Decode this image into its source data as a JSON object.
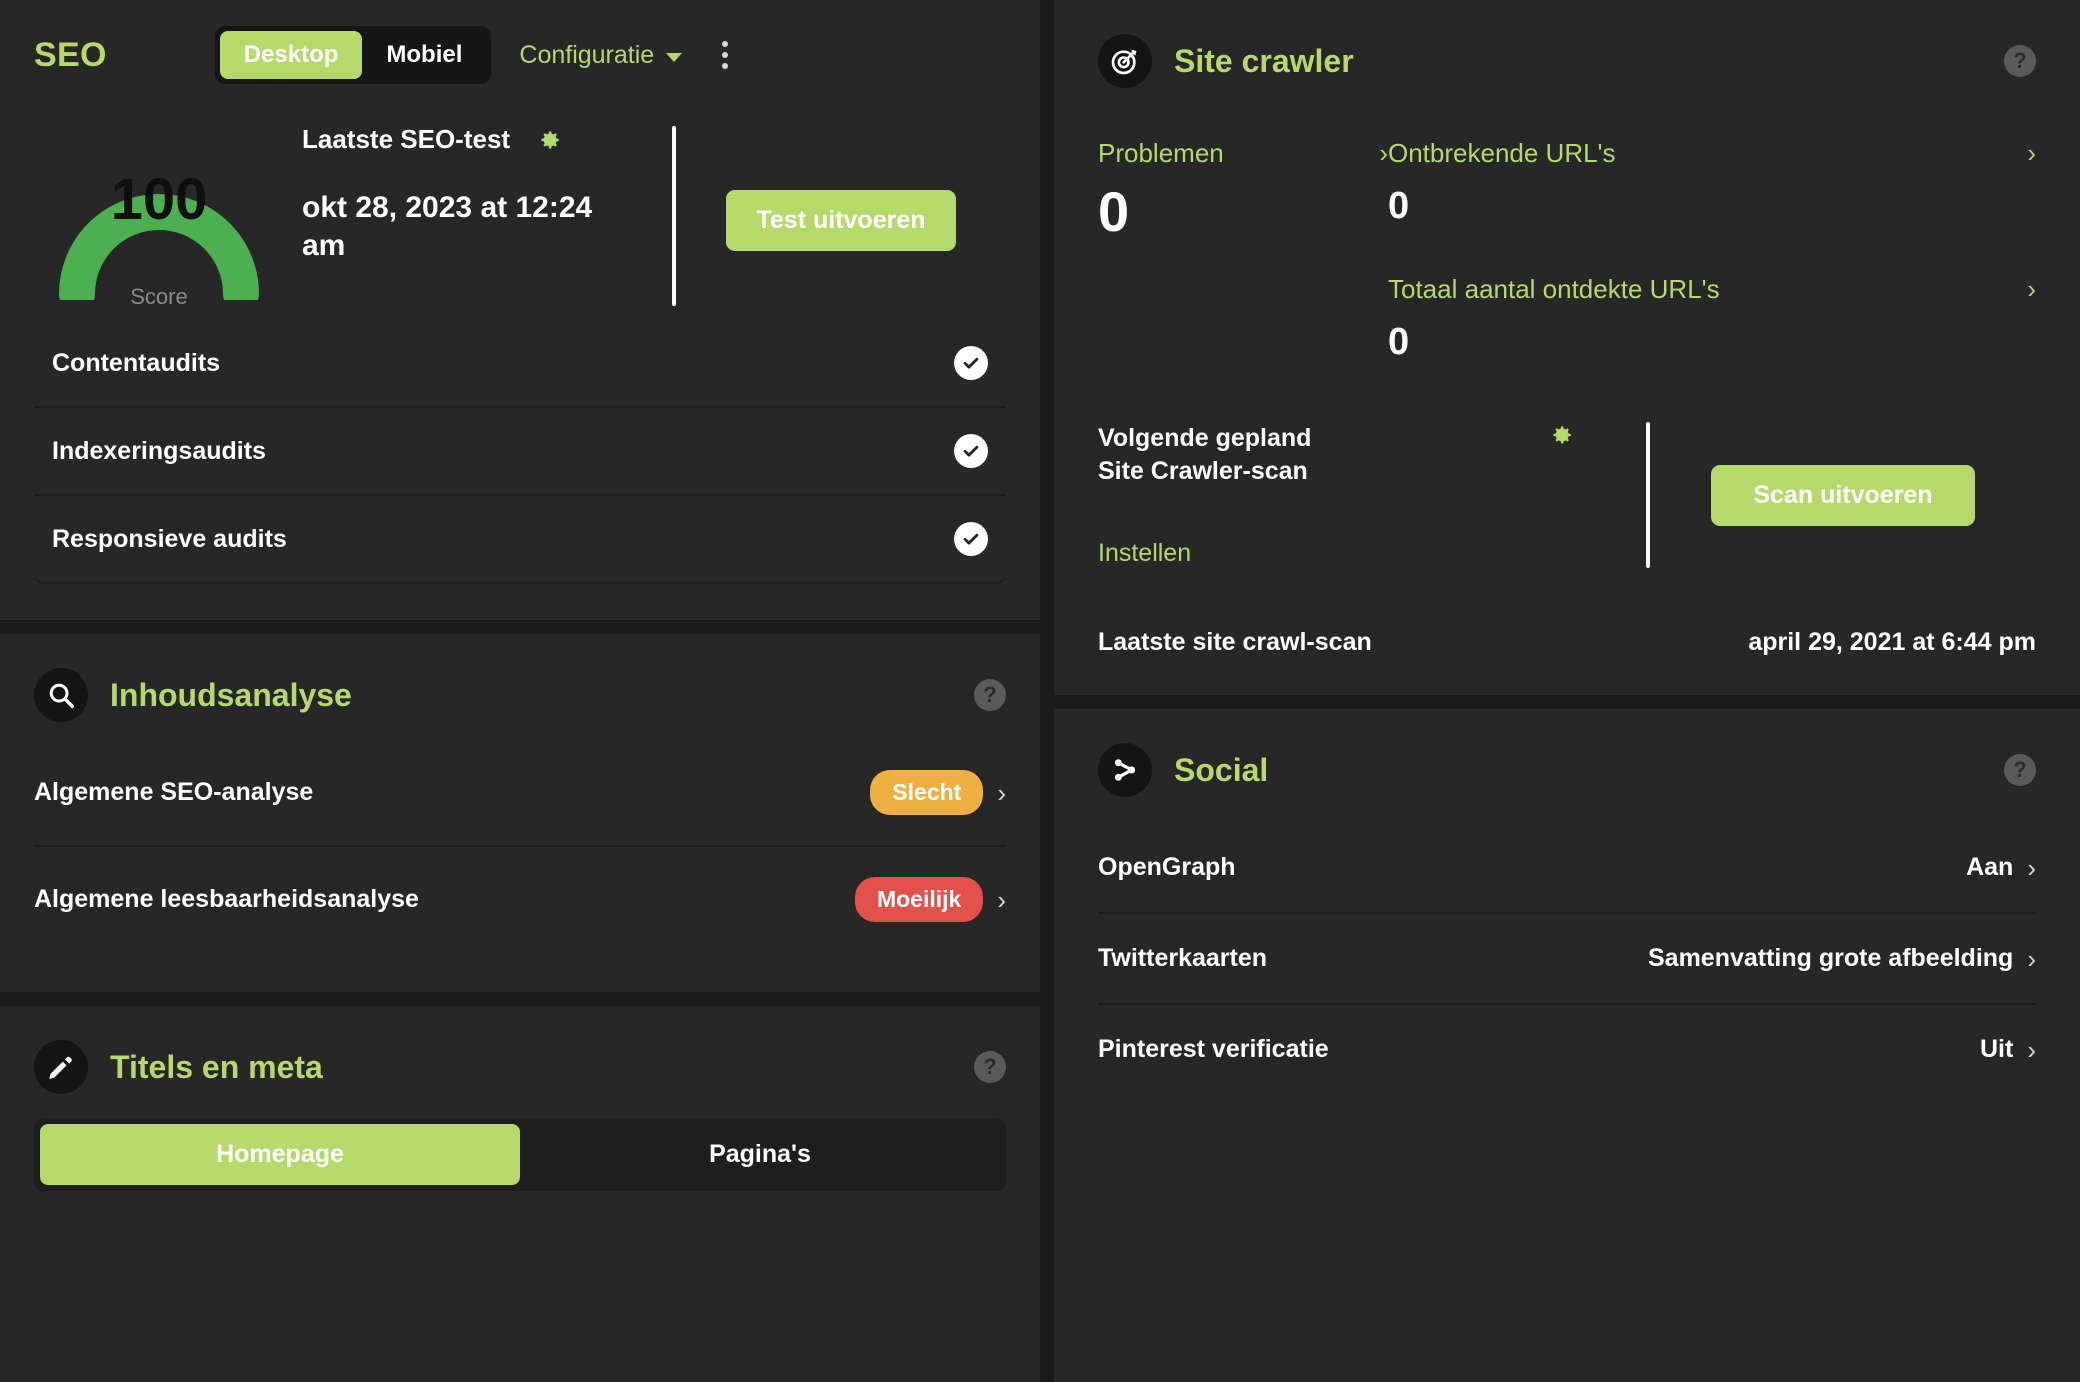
{
  "seo": {
    "title": "SEO",
    "device_toggle": {
      "options": [
        "Desktop",
        "Mobiel"
      ],
      "selected": "Desktop"
    },
    "config_label": "Configuratie",
    "gauge": {
      "value": "100",
      "label": "Score",
      "color": "#4caf50"
    },
    "last_test_label": "Laatste SEO-test",
    "last_test_date": "okt 28, 2023 at 12:24 am",
    "run_test_label": "Test uitvoeren",
    "audits": [
      {
        "label": "Contentaudits",
        "status": "check"
      },
      {
        "label": "Indexeringsaudits",
        "status": "check"
      },
      {
        "label": "Responsieve audits",
        "status": "check"
      }
    ]
  },
  "content_analysis": {
    "icon": "search-icon",
    "title": "Inhoudsanalyse",
    "help": "?",
    "rows": [
      {
        "label": "Algemene SEO-analyse",
        "badge": "Slecht",
        "badge_kind": "warn",
        "badge_color": "#efaf41"
      },
      {
        "label": "Algemene leesbaarheidsanalyse",
        "badge": "Moeilijk",
        "badge_kind": "bad",
        "badge_color": "#e2514b"
      }
    ]
  },
  "titles_meta": {
    "icon": "pencil-icon",
    "title": "Titels en meta",
    "help": "?",
    "tabs": [
      {
        "label": "Homepage",
        "active": true
      },
      {
        "label": "Pagina's",
        "active": false
      }
    ]
  },
  "site_crawler": {
    "icon": "target-icon",
    "title": "Site crawler",
    "help": "?",
    "stats": [
      {
        "label": "Problemen",
        "value": "0"
      },
      {
        "label": "Ontbrekende URL's",
        "value": "0"
      },
      {
        "label": "Totaal aantal ontdekte URL's",
        "value": "0"
      }
    ],
    "schedule_title": "Volgende gepland Site Crawler-scan",
    "schedule_line1": "Volgende gepland",
    "schedule_line2": "Site Crawler-scan",
    "settings_label": "Instellen",
    "run_scan_label": "Scan uitvoeren",
    "last_scan_label": "Laatste site crawl-scan",
    "last_scan_value": "april 29, 2021 at 6:44 pm"
  },
  "social": {
    "icon": "share-icon",
    "title": "Social",
    "help": "?",
    "rows": [
      {
        "label": "OpenGraph",
        "value": "Aan"
      },
      {
        "label": "Twitterkaarten",
        "value": "Samenvatting grote afbeelding"
      },
      {
        "label": "Pinterest verificatie",
        "value": "Uit"
      }
    ]
  },
  "theme": {
    "accent": "#b5d96a",
    "panel_bg": "#272727",
    "page_bg": "#1a1a1a",
    "gauge_green": "#4caf50"
  }
}
